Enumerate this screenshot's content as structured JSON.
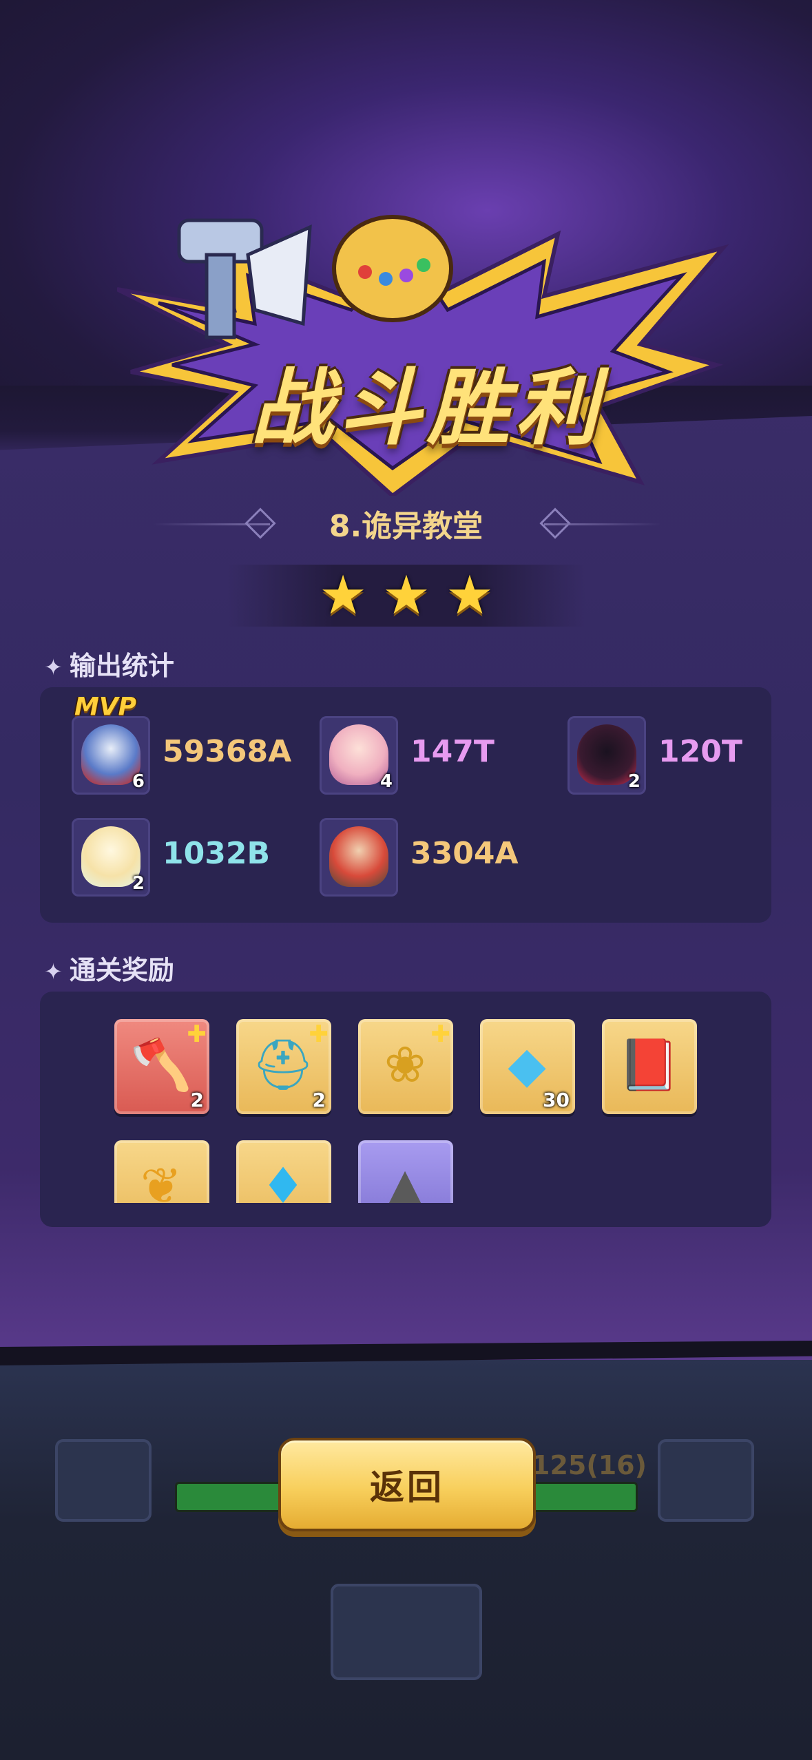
{
  "banner": {
    "title": "战斗胜利"
  },
  "stage": {
    "name": "8.诡异教堂",
    "stars": 3
  },
  "stats": {
    "title": "输出统计",
    "mvp_label": "MVP",
    "heroes": [
      {
        "damage": "59368A",
        "level": "6",
        "color": "#f4c77a",
        "art": "mecha-knight"
      },
      {
        "damage": "147T",
        "level": "4",
        "color": "#e79bf0",
        "art": "fox-girl"
      },
      {
        "damage": "120T",
        "level": "2",
        "color": "#e79bf0",
        "art": "imp"
      },
      {
        "damage": "1032B",
        "level": "2",
        "color": "#8fe3ea",
        "art": "angel"
      },
      {
        "damage": "3304A",
        "level": "",
        "color": "#f4c77a",
        "art": "red-knight"
      }
    ]
  },
  "rewards": {
    "title": "通关奖励",
    "items": [
      {
        "name": "axe-piece-icon",
        "qty": "2",
        "frame": "red"
      },
      {
        "name": "tower-helmet-piece-icon",
        "qty": "2",
        "frame": "gold"
      },
      {
        "name": "flower-piece-icon",
        "qty": "",
        "frame": "gold"
      },
      {
        "name": "crystal-cube-icon",
        "qty": "30",
        "frame": "gold"
      },
      {
        "name": "spellbook-icon",
        "qty": "",
        "frame": "gold"
      },
      {
        "name": "golden-wings-icon",
        "qty": "",
        "frame": "gold"
      },
      {
        "name": "diamond-icon",
        "qty": "",
        "frame": "gold"
      },
      {
        "name": "stone-shard-icon",
        "qty": "",
        "frame": "purple"
      }
    ]
  },
  "footer": {
    "back_label": "返回",
    "hp_text": "125(16)"
  }
}
